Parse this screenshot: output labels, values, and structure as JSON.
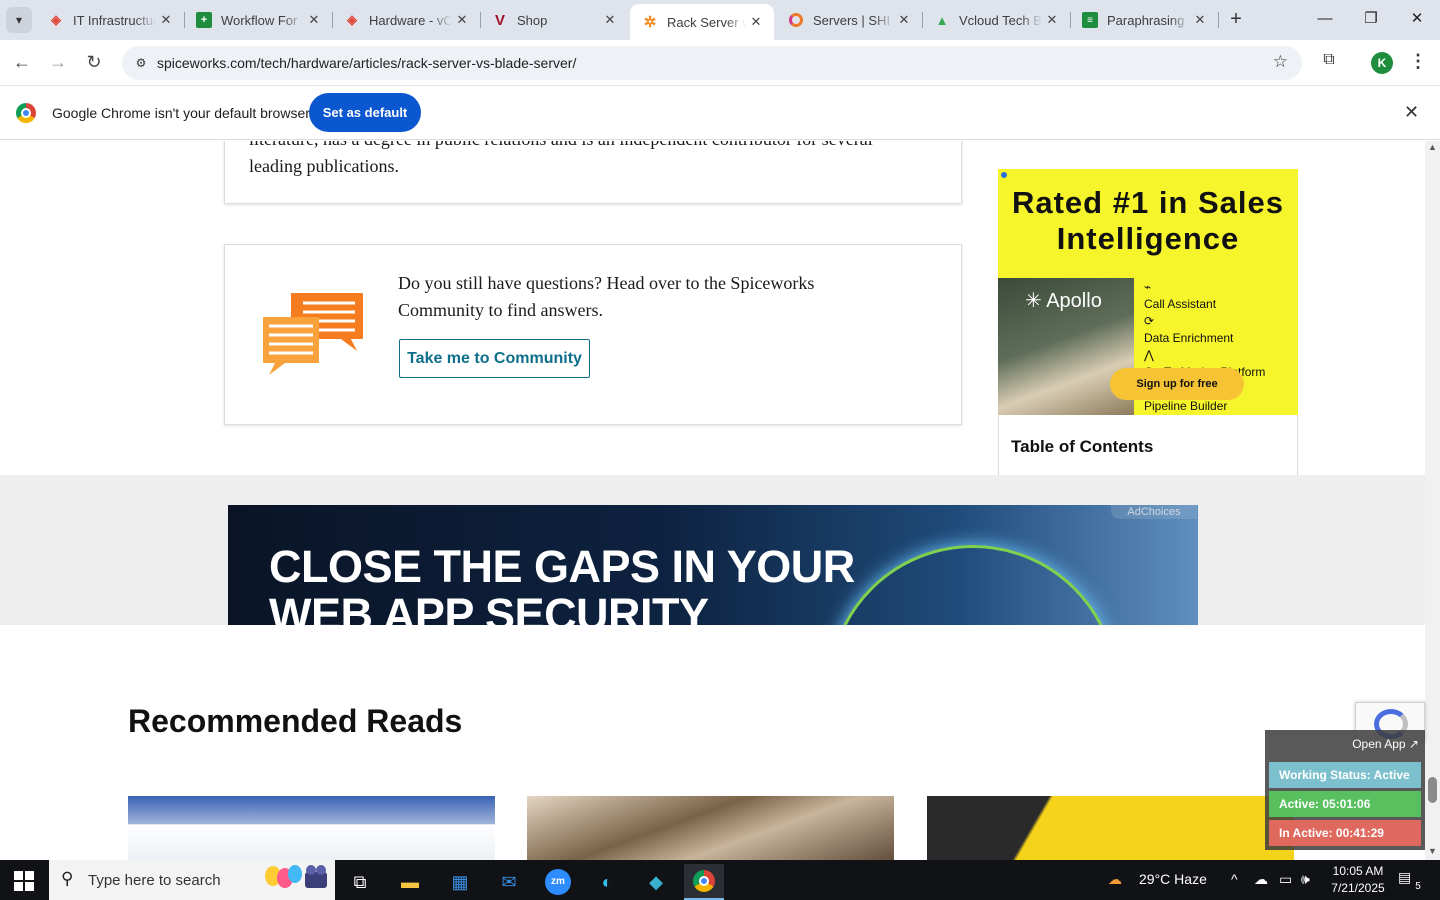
{
  "browser": {
    "tabs": [
      {
        "title": "IT Infrastructure",
        "favicon": "red-diamond-icon",
        "active": false
      },
      {
        "title": "Workflow For",
        "favicon": "green-sheet-icon",
        "active": false
      },
      {
        "title": "Hardware - vC",
        "favicon": "red-diamond-icon",
        "active": false
      },
      {
        "title": "Shop",
        "favicon": "v-logo-icon",
        "active": false
      },
      {
        "title": "Rack Server vs",
        "favicon": "spiceworks-icon",
        "active": true
      },
      {
        "title": "Servers | SHI",
        "favicon": "shi-ring-icon",
        "active": false
      },
      {
        "title": "Vcloud Tech B",
        "favicon": "drive-icon",
        "active": false
      },
      {
        "title": "Paraphrasing",
        "favicon": "green-doc-icon",
        "active": false
      }
    ],
    "url": "spiceworks.com/tech/hardware/articles/rack-server-vs-blade-server/",
    "profile_initial": "K",
    "infobar": {
      "message": "Google Chrome isn't your default browser",
      "button": "Set as default"
    }
  },
  "page": {
    "bio_text": "literature, has a degree in public relations and is an independent contributor for several leading publications.",
    "community_card": {
      "question": "Do you still have questions? Head over to the Spiceworks Community to find answers.",
      "button": "Take me to Community"
    },
    "apollo_ad": {
      "headline": "Rated #1 in Sales Intelligence",
      "logo": "Apollo",
      "features": [
        "Call Assistant",
        "Data Enrichment",
        "Go-To-Market Platform",
        "Pipeline Builder"
      ],
      "cta": "Sign up for free"
    },
    "toc_title": "Table of Contents",
    "banner_ad": {
      "headline": "CLOSE THE GAPS IN YOUR WEB APP SECURITY",
      "adchoices": "AdChoices"
    },
    "recommended_title": "Recommended Reads"
  },
  "tracker": {
    "open_app": "Open App ↗",
    "status": "Working Status: Active",
    "active": "Active: 05:01:06",
    "inactive": "In Active: 00:41:29"
  },
  "taskbar": {
    "search_placeholder": "Type here to search",
    "weather": "29°C  Haze",
    "time": "10:05 AM",
    "date": "7/21/2025",
    "notification_count": "5"
  }
}
